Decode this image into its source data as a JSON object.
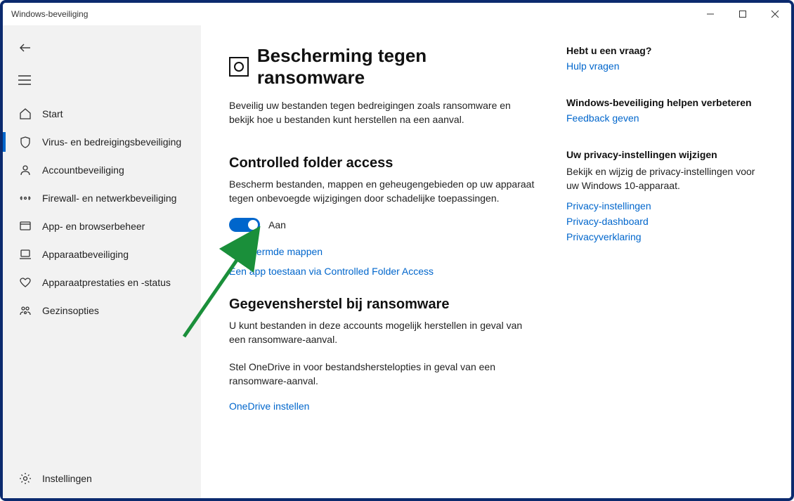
{
  "window": {
    "title": "Windows-beveiliging"
  },
  "sidebar": {
    "items": [
      {
        "label": "Start"
      },
      {
        "label": "Virus- en bedreigingsbeveiliging"
      },
      {
        "label": "Accountbeveiliging"
      },
      {
        "label": "Firewall- en netwerkbeveiliging"
      },
      {
        "label": "App- en browserbeheer"
      },
      {
        "label": "Apparaatbeveiliging"
      },
      {
        "label": "Apparaatprestaties en -status"
      },
      {
        "label": "Gezinsopties"
      }
    ],
    "settings_label": "Instellingen"
  },
  "page": {
    "title": "Bescherming tegen ransomware",
    "intro": "Beveilig uw bestanden tegen bedreigingen zoals ransomware en bekijk hoe u bestanden kunt herstellen na een aanval.",
    "cfa_heading": "Controlled folder access",
    "cfa_desc": "Bescherm bestanden, mappen en geheugengebieden op uw apparaat tegen onbevoegde wijzigingen door schadelijke toepassingen.",
    "toggle_state": "Aan",
    "link_protected": "Beschermde mappen",
    "link_allow_app": "Een app toestaan via Controlled Folder Access",
    "recovery_heading": "Gegevensherstel bij ransomware",
    "recovery_desc": "U kunt bestanden in deze accounts mogelijk herstellen in geval van een ransomware-aanval.",
    "onedrive_text": "Stel OneDrive in voor bestandsherstelopties in geval van een ransomware-aanval.",
    "onedrive_link": "OneDrive instellen"
  },
  "aside": {
    "question_heading": "Hebt u een vraag?",
    "question_link": "Hulp vragen",
    "help_heading": "Windows-beveiliging helpen verbeteren",
    "help_link": "Feedback geven",
    "privacy_heading": "Uw privacy-instellingen wijzigen",
    "privacy_text": "Bekijk en wijzig de privacy-instellingen voor uw Windows 10-apparaat.",
    "privacy_link1": "Privacy-instellingen",
    "privacy_link2": "Privacy-dashboard",
    "privacy_link3": "Privacyverklaring"
  }
}
